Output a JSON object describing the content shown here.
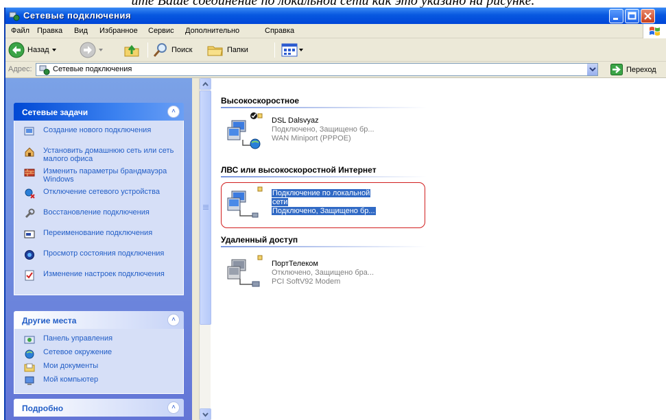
{
  "caption": "ите Ваше соединение по локальной сети как это указано на рисунке.",
  "window": {
    "title": "Сетевые подключения"
  },
  "menu": [
    "Файл",
    "Правка",
    "Вид",
    "Избранное",
    "Сервис",
    "Дополнительно",
    "Справка"
  ],
  "toolbar": {
    "back": "Назад",
    "search": "Поиск",
    "folders": "Папки"
  },
  "address": {
    "label": "Адрес:",
    "value": "Сетевые подключения",
    "go": "Переход"
  },
  "tasks": {
    "title": "Сетевые задачи",
    "items": [
      "Создание нового подключения",
      "Установить домашнюю сеть или сеть малого офиса",
      "Изменить параметры брандмауэра Windows",
      "Отключение сетевого устройства",
      "Восстановление подключения",
      "Переименование подключения",
      "Просмотр состояния подключения",
      "Изменение настроек подключения"
    ]
  },
  "places": {
    "title": "Другие места",
    "items": [
      "Панель управления",
      "Сетевое окружение",
      "Мои документы",
      "Мой компьютер"
    ]
  },
  "details": {
    "title": "Подробно"
  },
  "groups": [
    {
      "title": "Высокоскоростное",
      "conn": {
        "name": "DSL Dalsvyaz",
        "status": "Подключено, Защищено бр...",
        "device": "WAN Miniport (PPPOE)"
      }
    },
    {
      "title": "ЛВС или высокоскоростной Интернет",
      "conn": {
        "name_a": "Подключение по локальной",
        "name_b": "сети",
        "status": "Подключено, Защищено бр..."
      }
    },
    {
      "title": "Удаленный доступ",
      "conn": {
        "name": "ПортТелеком",
        "status": "Отключено, Защищено бра...",
        "device": "PCI SoftV92 Modem"
      }
    }
  ],
  "colors": {
    "titlebar": "#0058e0",
    "taskpane": "#6f8ee0",
    "link": "#215dc6",
    "selection": "#316ac5",
    "highlight_box": "#d11c1c"
  }
}
